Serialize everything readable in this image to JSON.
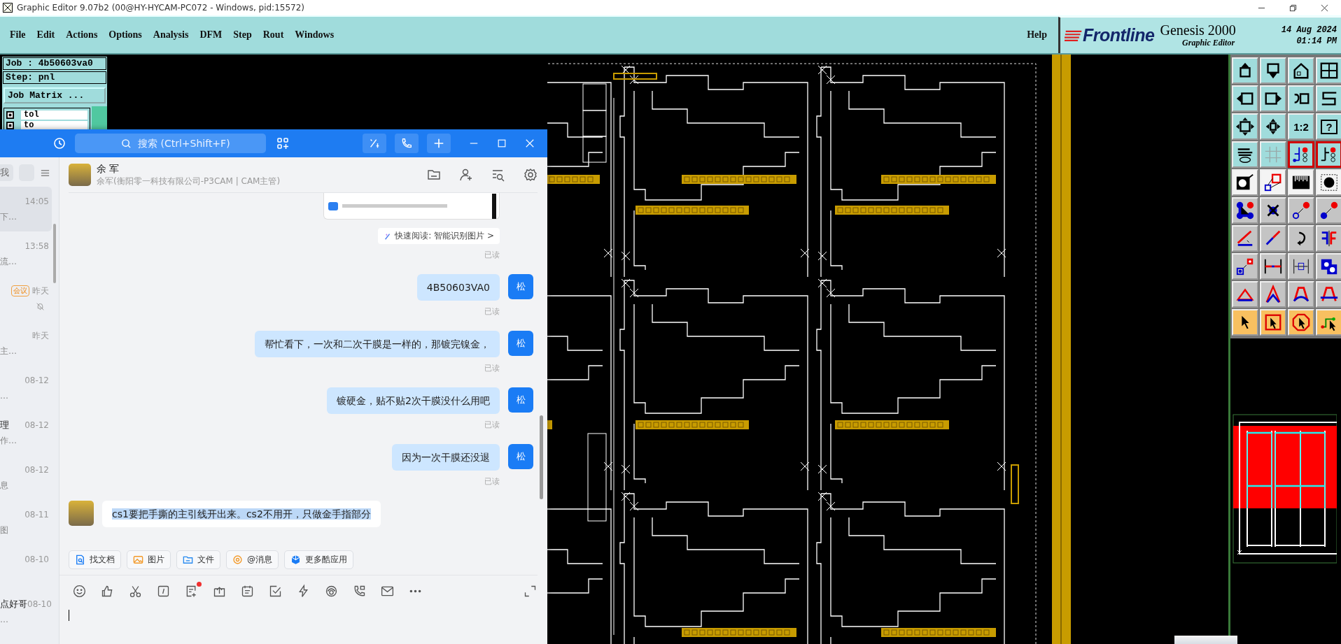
{
  "window": {
    "title": "Graphic Editor 9.07b2 (00@HY-HYCAM-PC072 - Windows, pid:15572)"
  },
  "menu": {
    "items": [
      "File",
      "Edit",
      "Actions",
      "Options",
      "Analysis",
      "DFM",
      "Step",
      "Rout",
      "Windows"
    ],
    "help": "Help"
  },
  "brand": {
    "logo": "Frontline",
    "product": "Genesis 2000",
    "module": "Graphic Editor",
    "date": "14 Aug 2024",
    "time": "01:14 PM"
  },
  "job_panel": {
    "job": "Job : 4b50603va0",
    "step": "Step: pnl",
    "matrix_button": "Job Matrix ...",
    "layers": [
      "tol",
      "to"
    ]
  },
  "tool_labels": [
    "1:2",
    "?"
  ],
  "chat": {
    "search": {
      "placeholder": "搜索 (Ctrl+Shift+F)"
    },
    "list_filter": "我",
    "conversations": [
      {
        "time": "14:05",
        "preview": "下…",
        "muted": false,
        "selected": true
      },
      {
        "time": "13:58",
        "preview": "流…",
        "muted": false,
        "selected": false
      },
      {
        "time": "昨天",
        "tag": "会议",
        "muted": true,
        "selected": false
      },
      {
        "time": "昨天",
        "preview": "主…",
        "muted": false,
        "selected": false
      },
      {
        "time": "08-12",
        "preview": "…",
        "muted": false,
        "selected": false
      },
      {
        "title": "理",
        "time": "08-12",
        "preview": "作…",
        "muted": false,
        "selected": false
      },
      {
        "time": "08-12",
        "preview": "息",
        "muted": false,
        "selected": false
      },
      {
        "time": "08-11",
        "preview": "图",
        "muted": false,
        "selected": false
      },
      {
        "time": "08-10",
        "muted": false,
        "selected": false
      },
      {
        "title": "点好哥",
        "time": "08-10",
        "preview": "…",
        "muted": false,
        "selected": false
      }
    ],
    "contact": {
      "name": "余 军",
      "subtitle": "余军(衡阳零一科技有限公司-P3CAM | CAM主管)"
    },
    "messages": [
      {
        "kind": "image",
        "note": "快速阅读: 智能识别图片 >",
        "status": "已读"
      },
      {
        "kind": "sent",
        "text": "4B50603VA0",
        "avatar": "松",
        "status": "已读",
        "highlighted": false
      },
      {
        "kind": "sent",
        "text": "帮忙看下，一次和二次干膜是一样的，那镀完镍金，",
        "avatar": "松",
        "status": "已读",
        "highlighted": false
      },
      {
        "kind": "sent",
        "text": "镀硬金，贴不贴2次干膜没什么用吧",
        "avatar": "松",
        "status": "已读",
        "highlighted": false
      },
      {
        "kind": "sent",
        "text": "因为一次干膜还没退",
        "avatar": "松",
        "status": "已读",
        "highlighted": false
      },
      {
        "kind": "received",
        "text": "cs1要把手撕的主引线开出来。cs2不用开，只做金手指部分",
        "highlighted": true
      }
    ],
    "quick_actions": [
      {
        "kind": "doc",
        "label": "找文档"
      },
      {
        "kind": "image",
        "label": "图片"
      },
      {
        "kind": "folder",
        "label": "文件"
      },
      {
        "kind": "at",
        "label": "@消息"
      },
      {
        "kind": "apps",
        "label": "更多酷应用"
      }
    ]
  }
}
